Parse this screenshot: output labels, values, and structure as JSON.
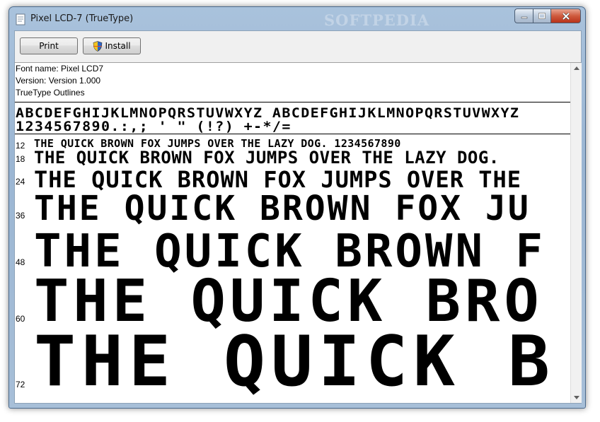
{
  "window": {
    "title": "Pixel LCD-7 (TrueType)",
    "watermark": "SOFTPEDIA"
  },
  "toolbar": {
    "print_label": "Print",
    "install_label": "Install"
  },
  "font_info": {
    "name_line": "Font name: Pixel LCD7",
    "version_line": "Version: Version 1.000",
    "outline_line": "TrueType Outlines"
  },
  "charset": {
    "line1": "ABCDEFGHIJKLMNOPQRSTUVWXYZ ABCDEFGHIJKLMNOPQRSTUVWXYZ",
    "line2": "1234567890.:,; ' \" (!?) +-*/="
  },
  "samples": [
    {
      "size": "12",
      "text": "THE QUICK BROWN FOX JUMPS OVER THE LAZY DOG. 1234567890"
    },
    {
      "size": "18",
      "text": "THE QUICK BROWN FOX JUMPS OVER THE LAZY DOG."
    },
    {
      "size": "24",
      "text": "THE QUICK BROWN FOX JUMPS OVER THE"
    },
    {
      "size": "36",
      "text": "THE QUICK BROWN FOX JU"
    },
    {
      "size": "48",
      "text": "THE QUICK BROWN F"
    },
    {
      "size": "60",
      "text": "THE QUICK BRO"
    },
    {
      "size": "72",
      "text": "THE QUICK B"
    }
  ],
  "colors": {
    "frame": "#a9c2dc",
    "close_button": "#cf5b3e",
    "text": "#000000"
  }
}
